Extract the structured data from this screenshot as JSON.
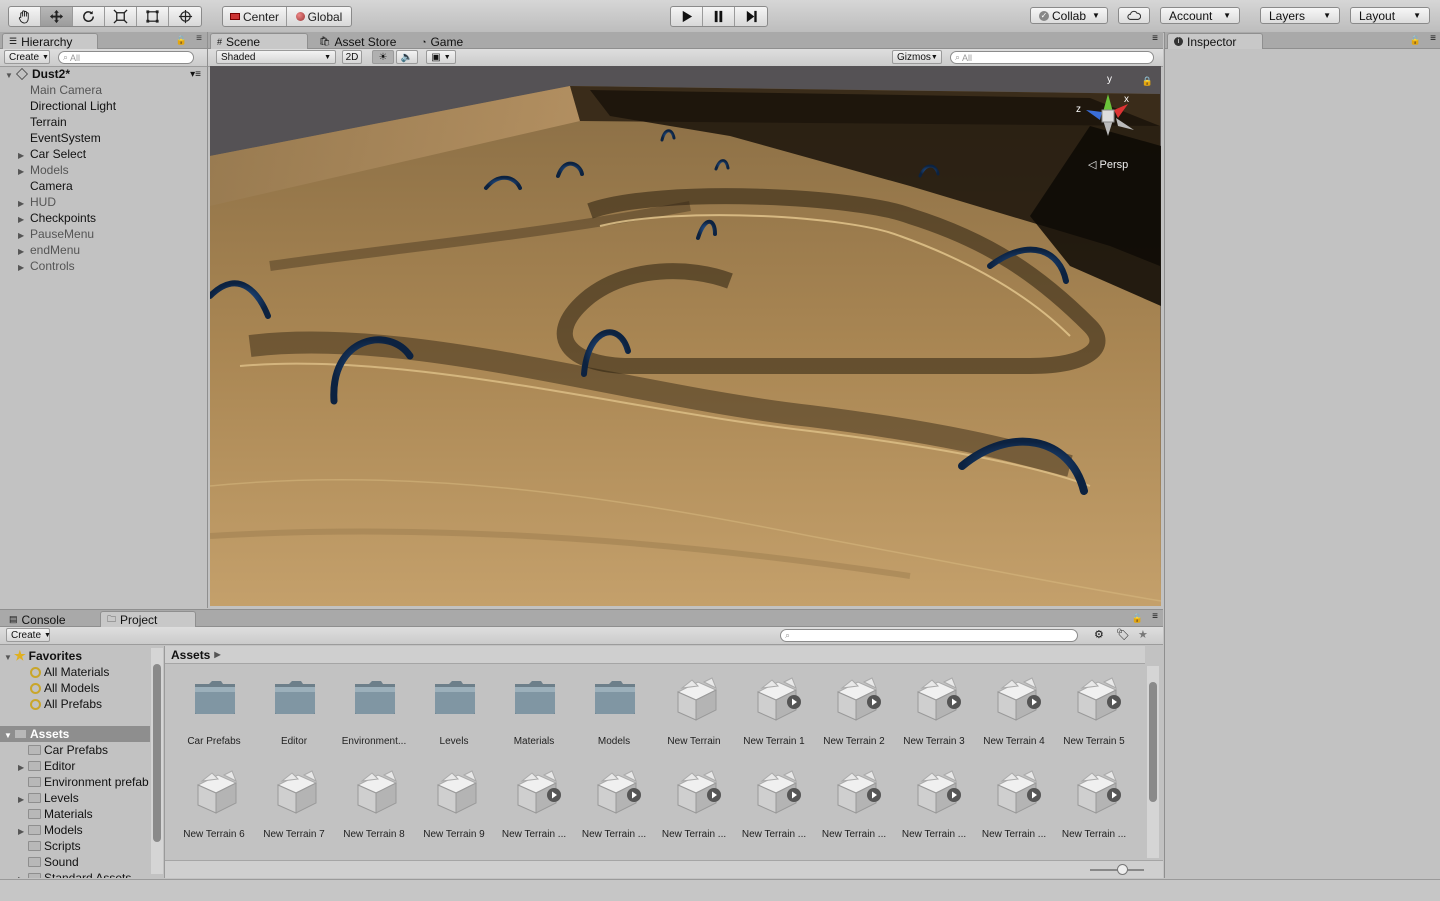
{
  "toolbar": {
    "tools": [
      "hand-tool",
      "move-tool",
      "rotate-tool",
      "scale-tool",
      "rect-tool",
      "transform-tool"
    ],
    "pivot": "Center",
    "space": "Global",
    "collab": "Collab",
    "account": "Account",
    "layers": "Layers",
    "layout": "Layout"
  },
  "hierarchy": {
    "tab": "Hierarchy",
    "create": "Create",
    "search_placeholder": "All",
    "scene": "Dust2*",
    "items": [
      {
        "label": "Main Camera",
        "expandable": false,
        "dim": true
      },
      {
        "label": "Directional Light",
        "expandable": false,
        "dim": false
      },
      {
        "label": "Terrain",
        "expandable": false,
        "dim": false
      },
      {
        "label": "EventSystem",
        "expandable": false,
        "dim": false
      },
      {
        "label": "Car Select",
        "expandable": true,
        "dim": false
      },
      {
        "label": "Models",
        "expandable": true,
        "dim": true
      },
      {
        "label": "Camera",
        "expandable": false,
        "dim": false
      },
      {
        "label": "HUD",
        "expandable": true,
        "dim": true
      },
      {
        "label": "Checkpoints",
        "expandable": true,
        "dim": false
      },
      {
        "label": "PauseMenu",
        "expandable": true,
        "dim": true
      },
      {
        "label": "endMenu",
        "expandable": true,
        "dim": true
      },
      {
        "label": "Controls",
        "expandable": true,
        "dim": true
      }
    ]
  },
  "scene_tabs": {
    "scene": "Scene",
    "asset_store": "Asset Store",
    "game": "Game"
  },
  "scene_toolbar": {
    "shading": "Shaded",
    "mode_2d": "2D",
    "gizmos": "Gizmos",
    "search_placeholder": "All"
  },
  "scene_view": {
    "projection": "Persp",
    "axis_y": "y",
    "axis_x": "x",
    "axis_z": "z"
  },
  "inspector": {
    "tab": "Inspector"
  },
  "bottom_tabs": {
    "console": "Console",
    "project": "Project"
  },
  "project": {
    "create": "Create",
    "favorites": "Favorites",
    "favorite_items": [
      "All Materials",
      "All Models",
      "All Prefabs"
    ],
    "assets_root": "Assets",
    "asset_folders": [
      {
        "label": "Car Prefabs",
        "expandable": false
      },
      {
        "label": "Editor",
        "expandable": true
      },
      {
        "label": "Environment prefab",
        "expandable": false
      },
      {
        "label": "Levels",
        "expandable": true
      },
      {
        "label": "Materials",
        "expandable": false
      },
      {
        "label": "Models",
        "expandable": true
      },
      {
        "label": "Scripts",
        "expandable": false
      },
      {
        "label": "Sound",
        "expandable": false
      },
      {
        "label": "Standard Assets",
        "expandable": true
      }
    ],
    "breadcrumb": "Assets",
    "grid_row1": [
      {
        "label": "Car Prefabs",
        "kind": "folder"
      },
      {
        "label": "Editor",
        "kind": "folder"
      },
      {
        "label": "Environment...",
        "kind": "folder"
      },
      {
        "label": "Levels",
        "kind": "folder"
      },
      {
        "label": "Materials",
        "kind": "folder"
      },
      {
        "label": "Models",
        "kind": "folder"
      },
      {
        "label": "New Terrain",
        "kind": "terrain"
      },
      {
        "label": "New Terrain 1",
        "kind": "terrain-play"
      },
      {
        "label": "New Terrain 2",
        "kind": "terrain-play"
      },
      {
        "label": "New Terrain 3",
        "kind": "terrain-play"
      },
      {
        "label": "New Terrain 4",
        "kind": "terrain-play"
      },
      {
        "label": "New Terrain 5",
        "kind": "terrain-play"
      }
    ],
    "grid_row2": [
      {
        "label": "New Terrain 6",
        "kind": "terrain"
      },
      {
        "label": "New Terrain 7",
        "kind": "terrain"
      },
      {
        "label": "New Terrain 8",
        "kind": "terrain"
      },
      {
        "label": "New Terrain 9",
        "kind": "terrain"
      },
      {
        "label": "New Terrain ...",
        "kind": "terrain-play"
      },
      {
        "label": "New Terrain ...",
        "kind": "terrain-play"
      },
      {
        "label": "New Terrain ...",
        "kind": "terrain-play"
      },
      {
        "label": "New Terrain ...",
        "kind": "terrain-play"
      },
      {
        "label": "New Terrain ...",
        "kind": "terrain-play"
      },
      {
        "label": "New Terrain ...",
        "kind": "terrain-play"
      },
      {
        "label": "New Terrain ...",
        "kind": "terrain-play"
      },
      {
        "label": "New Terrain ...",
        "kind": "terrain-play"
      }
    ]
  },
  "colors": {
    "sand": "#b8925a",
    "sky": "#555255",
    "ring": "#1f4f8c",
    "selection": "#8e8e8e"
  }
}
